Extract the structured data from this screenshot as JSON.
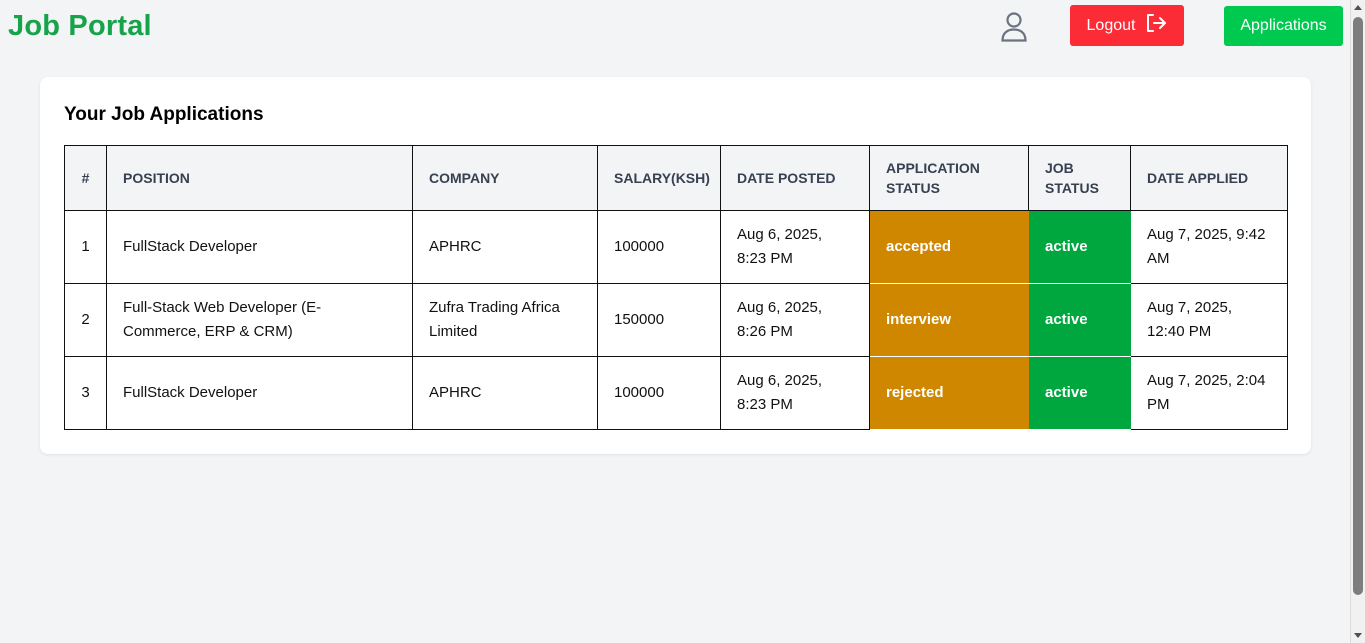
{
  "header": {
    "brand": "Job Portal",
    "user_icon": "user-icon",
    "logout_label": "Logout",
    "logout_icon": "logout-icon",
    "applications_label": "Applications"
  },
  "colors": {
    "brand": "#16a34a",
    "logout": "#fb2c36",
    "applications": "#00c950",
    "application_status": "#d08700",
    "job_status": "#00a63e"
  },
  "card": {
    "title": "Your Job Applications"
  },
  "table": {
    "columns": [
      "#",
      "POSITION",
      "COMPANY",
      "SALARY(KSH)",
      "DATE POSTED",
      "APPLICATION STATUS",
      "JOB STATUS",
      "DATE APPLIED"
    ],
    "rows": [
      {
        "num": "1",
        "position": "FullStack Developer",
        "company": "APHRC",
        "salary": "100000",
        "date_posted": "Aug 6, 2025, 8:23 PM",
        "application_status": "accepted",
        "job_status": "active",
        "date_applied": "Aug 7, 2025, 9:42 AM"
      },
      {
        "num": "2",
        "position": "Full-Stack Web Developer (E-Commerce, ERP & CRM)",
        "company": "Zufra Trading Africa Limited",
        "salary": "150000",
        "date_posted": "Aug 6, 2025, 8:26 PM",
        "application_status": "interview",
        "job_status": "active",
        "date_applied": "Aug 7, 2025, 12:40 PM"
      },
      {
        "num": "3",
        "position": "FullStack Developer",
        "company": "APHRC",
        "salary": "100000",
        "date_posted": "Aug 6, 2025, 8:23 PM",
        "application_status": "rejected",
        "job_status": "active",
        "date_applied": "Aug 7, 2025, 2:04 PM"
      }
    ]
  }
}
